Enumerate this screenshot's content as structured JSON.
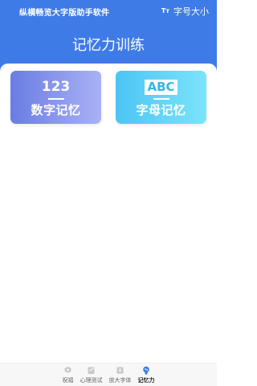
{
  "statusbar": {
    "app_title": "纵横畅览大字版助手软件",
    "font_size_icon": "Tт",
    "font_size_label": "字号大小"
  },
  "page": {
    "title": "记忆力训练"
  },
  "cards": [
    {
      "top": "123",
      "label": "数字记忆"
    },
    {
      "top": "ABC",
      "label": "字母记忆"
    }
  ],
  "bottom_nav": [
    {
      "label": "祝福",
      "icon": "blessing-icon",
      "active": false
    },
    {
      "label": "心理测试",
      "icon": "psychology-test-icon",
      "active": false
    },
    {
      "label": "放大字体",
      "icon": "enlarge-font-icon",
      "active": false
    },
    {
      "label": "记忆力",
      "icon": "memory-brain-icon",
      "active": true
    }
  ],
  "colors": {
    "header_blue": "#3f7be6",
    "numbers_card_start": "#6a7ce4",
    "numbers_card_end": "#a9b2f5",
    "letters_card_start": "#4cc5f3",
    "letters_card_end": "#7ce3fb",
    "active_nav": "#3f7be6"
  }
}
